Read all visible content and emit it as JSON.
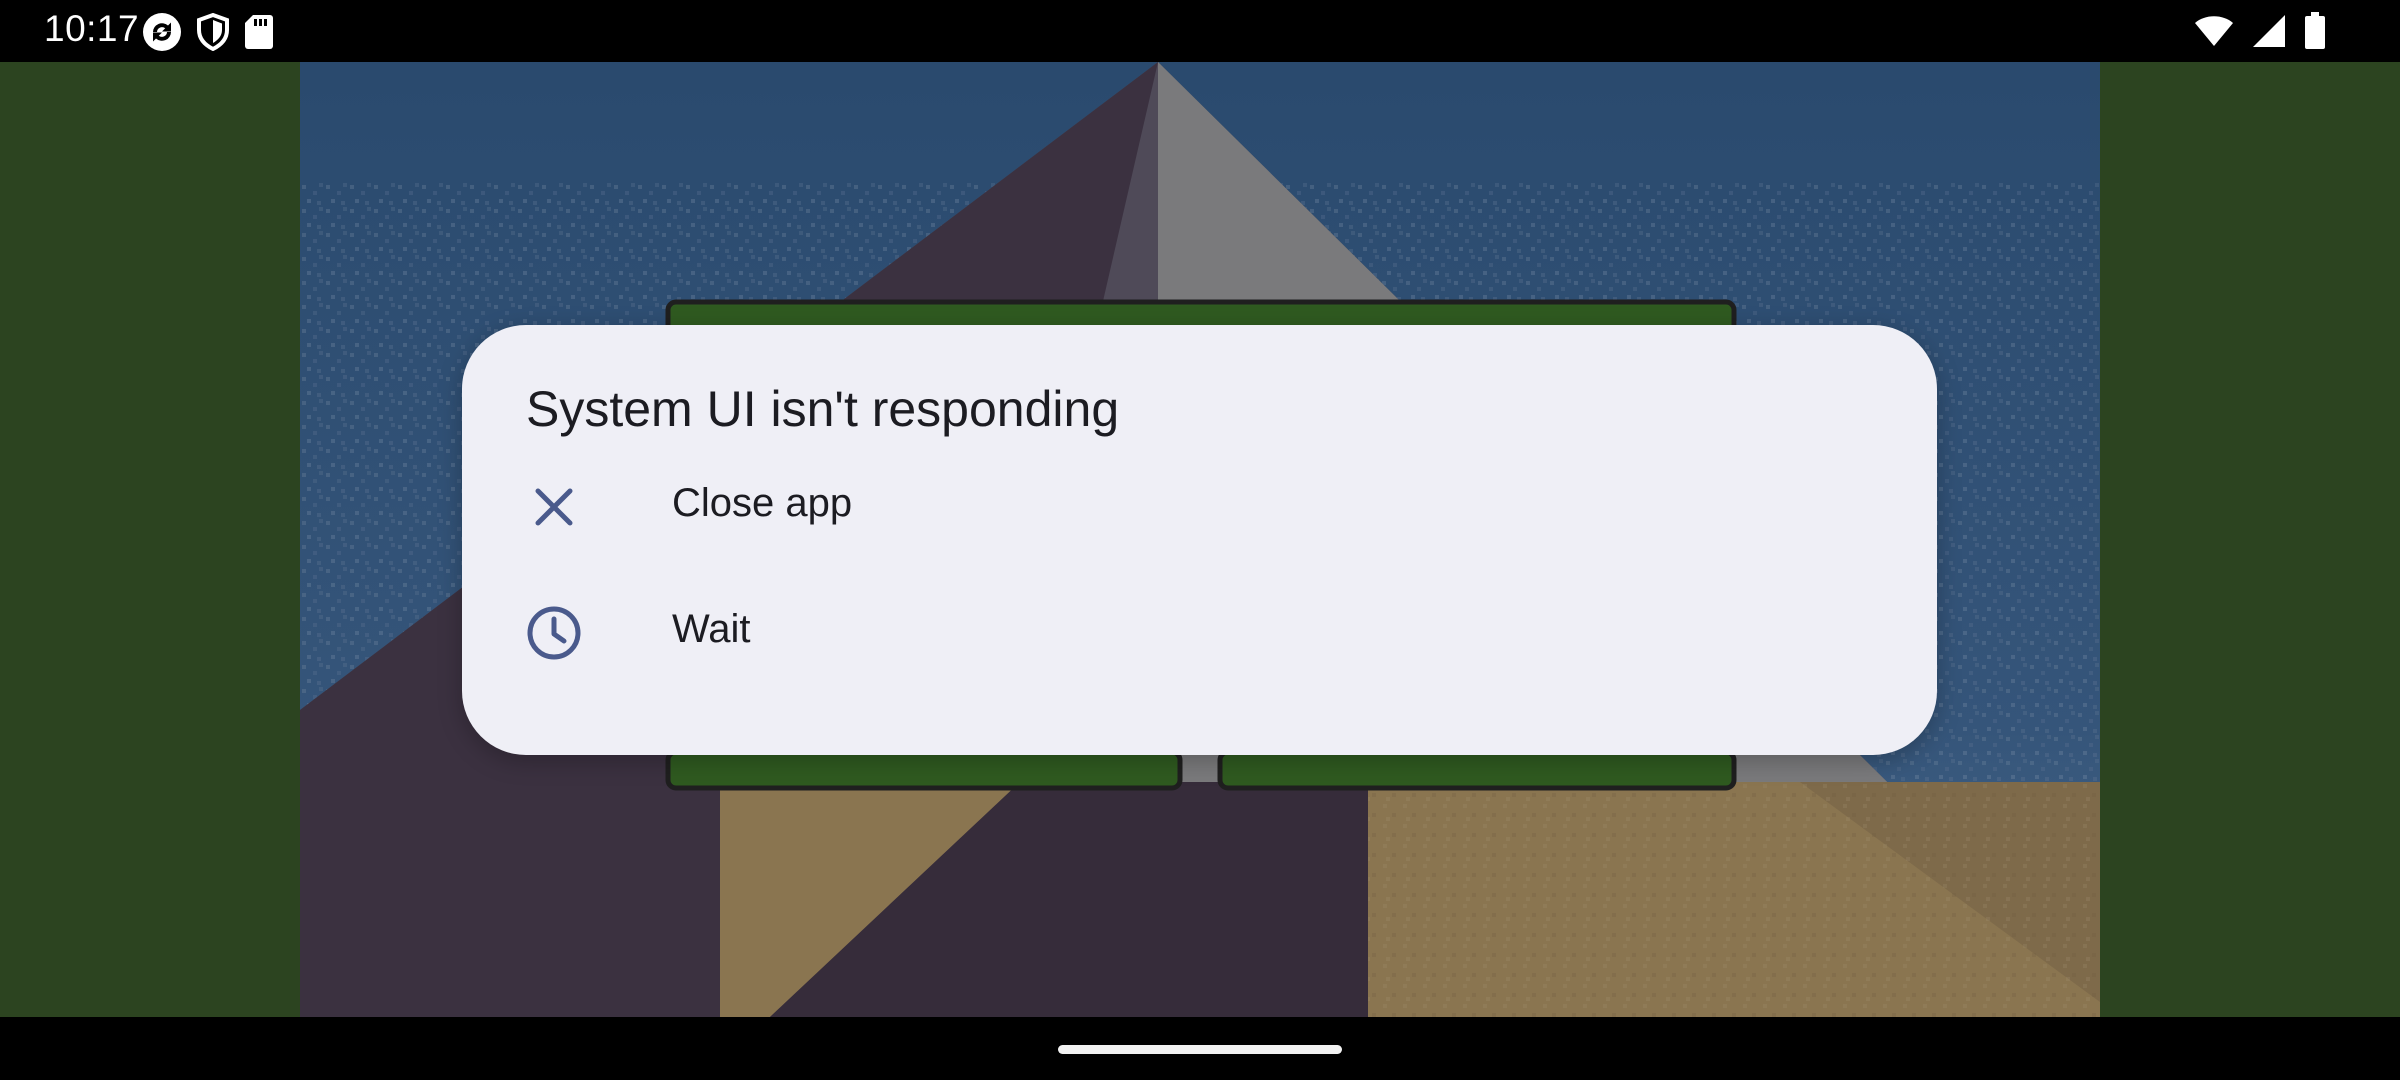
{
  "status_bar": {
    "time": "10:17",
    "left_icons": [
      "sync-icon",
      "shield-icon",
      "sd-card-icon"
    ],
    "right_icons": [
      "wifi-icon",
      "cellular-signal-icon",
      "battery-icon"
    ]
  },
  "dialog": {
    "title": "System UI isn't responding",
    "options": [
      {
        "label": "Close app",
        "icon": "close-icon"
      },
      {
        "label": "Wait",
        "icon": "clock-icon"
      }
    ]
  },
  "colors": {
    "dialog_background": "#efeff6",
    "icon_accent": "#4a5a8c",
    "side_background": "#2c4420",
    "sky": "#2a4a6e"
  }
}
